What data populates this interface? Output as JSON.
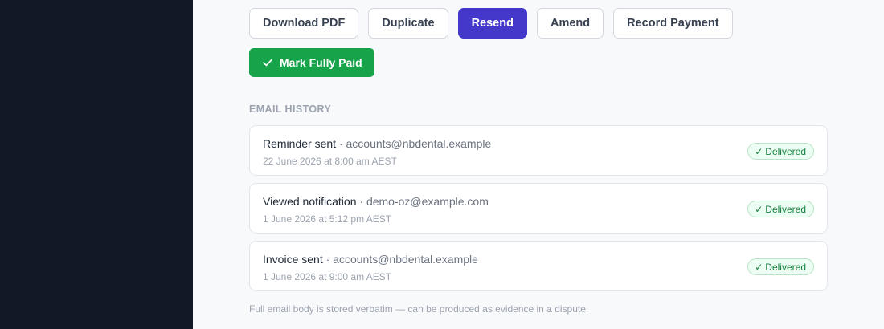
{
  "actions": {
    "download_pdf": "Download PDF",
    "duplicate": "Duplicate",
    "resend": "Resend",
    "amend": "Amend",
    "record_payment": "Record Payment",
    "mark_fully_paid": "Mark Fully Paid"
  },
  "email_history": {
    "title": "EMAIL HISTORY",
    "separator": "·",
    "items": [
      {
        "type": "Reminder sent",
        "recipient": "accounts@nbdental.example",
        "timestamp": "22 June 2026 at 8:00 am AEST",
        "status": "Delivered",
        "status_icon": "✓"
      },
      {
        "type": "Viewed notification",
        "recipient": "demo-oz@example.com",
        "timestamp": "1 June 2026 at 5:12 pm AEST",
        "status": "Delivered",
        "status_icon": "✓"
      },
      {
        "type": "Invoice sent",
        "recipient": "accounts@nbdental.example",
        "timestamp": "1 June 2026 at 9:00 am AEST",
        "status": "Delivered",
        "status_icon": "✓"
      }
    ],
    "footnote": "Full email body is stored verbatim — can be produced as evidence in a dispute."
  },
  "colors": {
    "sidebar": "#121826",
    "primary": "#4338ca",
    "success": "#16a34a",
    "badge_text": "#15803d",
    "badge_bg": "#ecfdf3"
  }
}
